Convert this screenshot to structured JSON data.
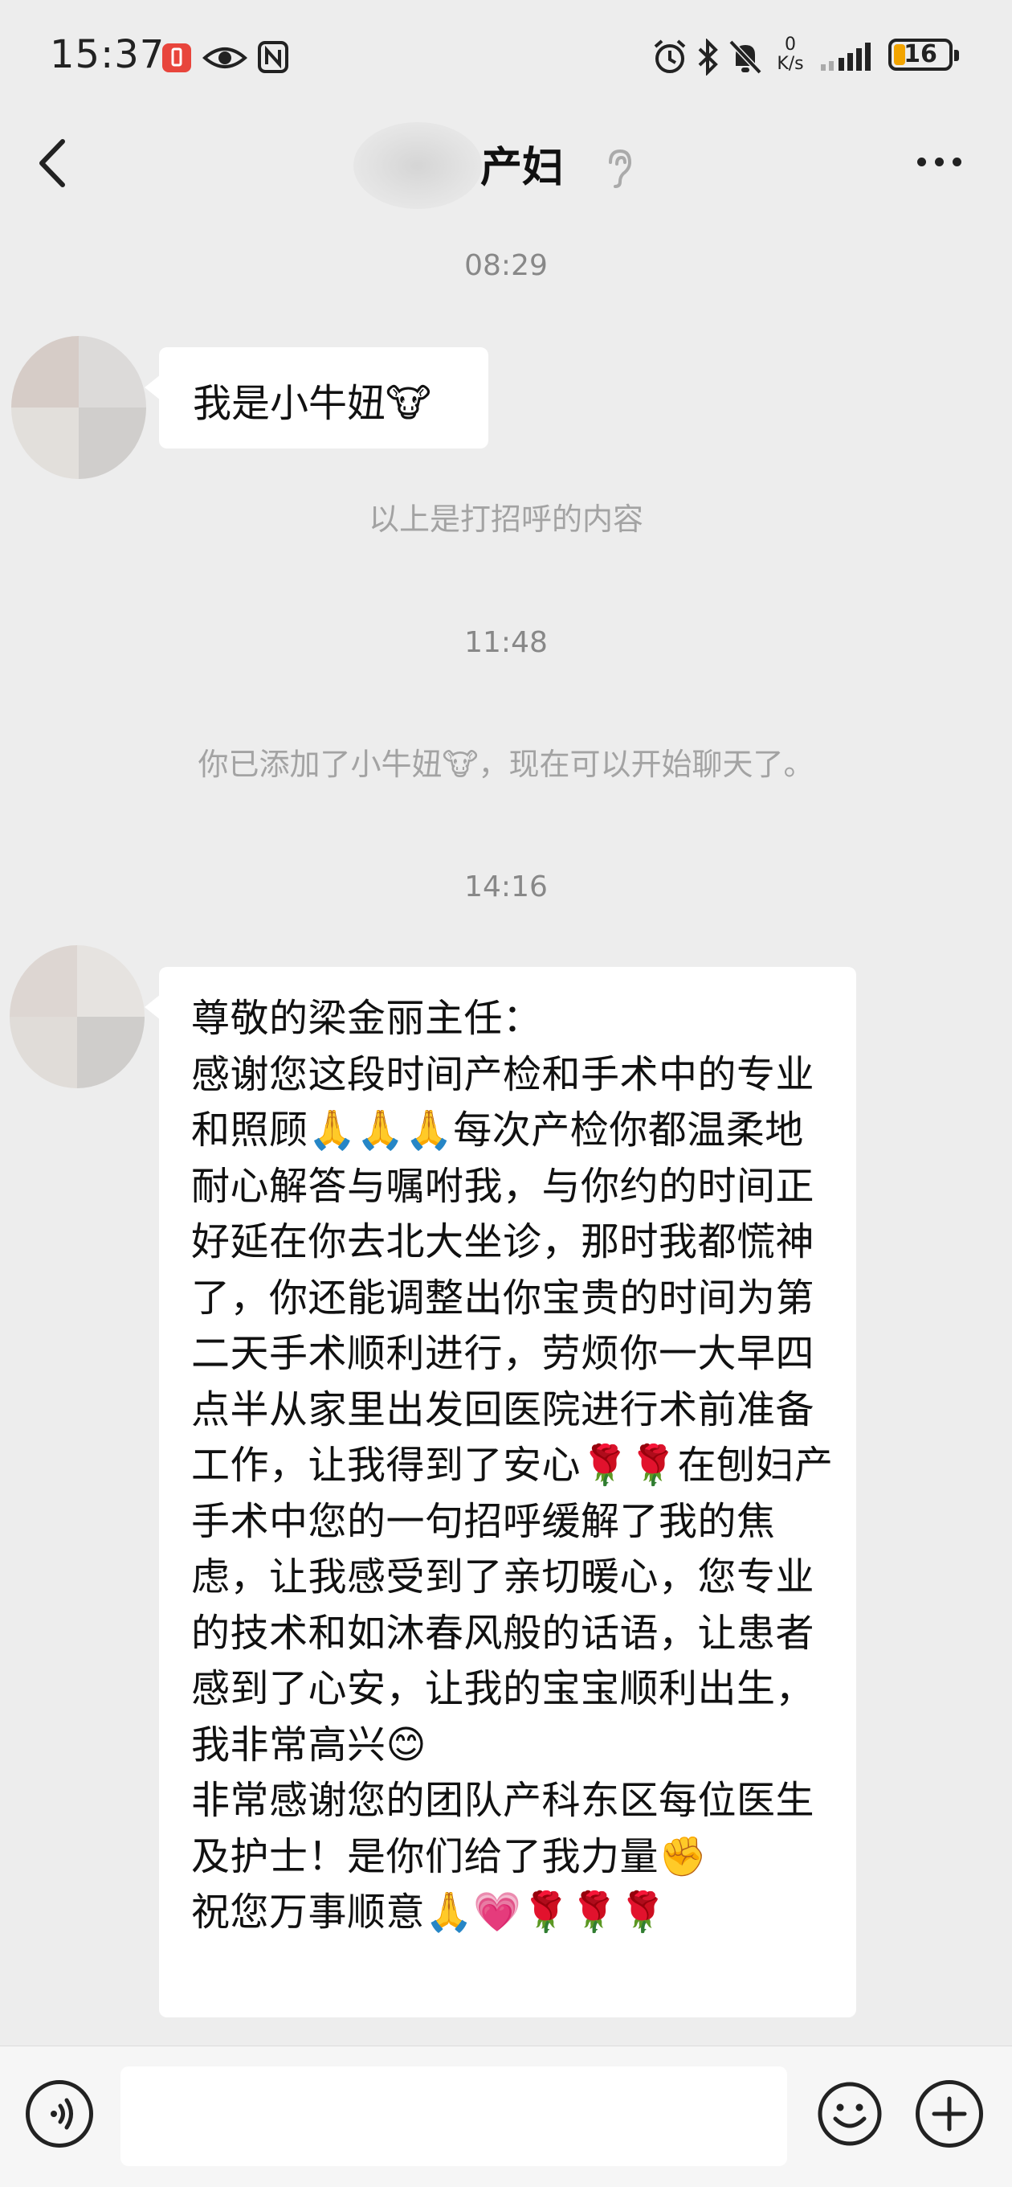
{
  "status_bar": {
    "time": "15:37",
    "speed_value": "0",
    "speed_unit": "K/s",
    "battery": "16",
    "icons": [
      "battery-saver-icon",
      "eye-icon",
      "nfc-icon",
      "alarm-icon",
      "bluetooth-icon",
      "mute-icon",
      "network-speed",
      "signal-icon",
      "battery-icon"
    ]
  },
  "header": {
    "title": "产妇",
    "icons": [
      "back-icon",
      "ear-icon",
      "more-icon"
    ]
  },
  "chat": {
    "timestamps": [
      "08:29",
      "11:48",
      "14:16"
    ],
    "greeting_message": "我是小牛妞🐮",
    "greeting_note": "以上是打招呼的内容",
    "added_notice": "你已添加了小牛妞🐮，现在可以开始聊天了。",
    "long_message": "尊敬的梁金丽主任：\n感谢您这段时间产检和手术中的专业和照顾🙏🙏🙏每次产检你都温柔地耐心解答与嘱咐我，与你约的时间正好延在你去北大坐诊，那时我都慌神了，你还能调整出你宝贵的时间为第二天手术顺利进行，劳烦你一大早四点半从家里出发回医院进行术前准备工作，让我得到了安心🌹🌹在刨妇产手术中您的一句招呼缓解了我的焦虑，让我感受到了亲切暖心，您专业的技术和如沐春风般的话语，让患者感到了心安，让我的宝宝顺利出生，我非常高兴😊\n非常感谢您的团队产科东区每位医生及护士！是你们给了我力量✊\n祝您万事顺意🙏💗🌹🌹🌹"
  },
  "input_bar": {
    "icons": [
      "voice-icon",
      "emoji-icon",
      "plus-icon"
    ]
  },
  "colors": {
    "background": "#ededed",
    "bubble": "#ffffff",
    "timestamp_text": "#888888",
    "system_text": "#a3a3a3"
  }
}
